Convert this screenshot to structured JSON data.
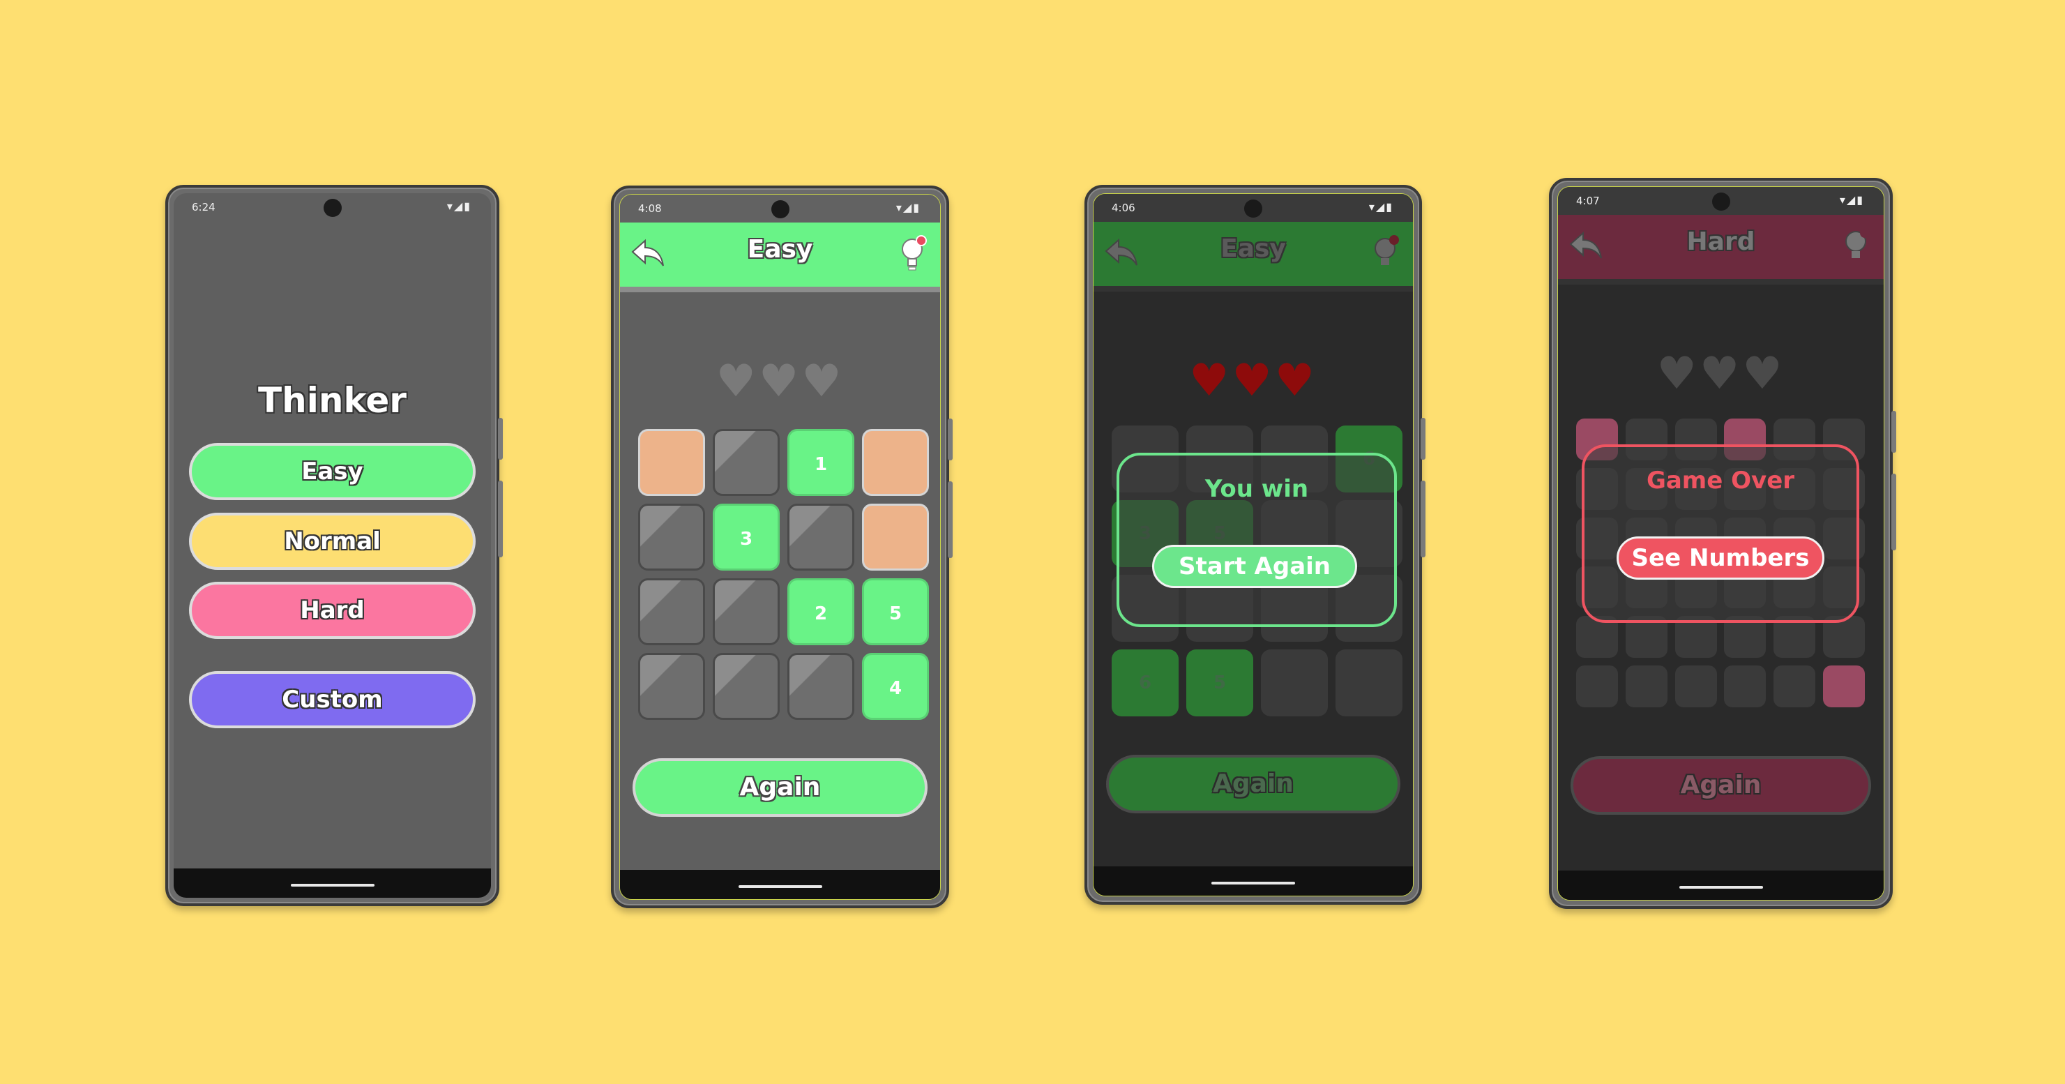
{
  "colors": {
    "background": "#FEDF71",
    "easy": "#69F387",
    "normal": "#FDDE72",
    "hard": "#FB76A0",
    "custom": "#7F6BF0",
    "revealed_tile": "#EDB38A",
    "hidden_tile": "#707070",
    "heart_gray": "#7a7a7a",
    "heart_red": "#8E0B0B",
    "win": "#6CE68C",
    "lose": "#EF5461"
  },
  "screens": [
    {
      "status_time": "6:24",
      "app_title": "Thinker",
      "menu": [
        "Easy",
        "Normal",
        "Hard",
        "Custom"
      ]
    },
    {
      "status_time": "4:08",
      "title": "Easy",
      "hearts": [
        "heart",
        "heart",
        "heart"
      ],
      "grid_rows": [
        [
          {
            "state": "revealed",
            "label": ""
          },
          {
            "state": "hidden",
            "label": ""
          },
          {
            "state": "number",
            "label": "1"
          },
          {
            "state": "revealed",
            "label": ""
          }
        ],
        [
          {
            "state": "hidden",
            "label": ""
          },
          {
            "state": "number",
            "label": "3"
          },
          {
            "state": "hidden",
            "label": ""
          },
          {
            "state": "revealed",
            "label": ""
          }
        ],
        [
          {
            "state": "hidden",
            "label": ""
          },
          {
            "state": "hidden",
            "label": ""
          },
          {
            "state": "number",
            "label": "2"
          },
          {
            "state": "number",
            "label": "5"
          }
        ],
        [
          {
            "state": "hidden",
            "label": ""
          },
          {
            "state": "hidden",
            "label": ""
          },
          {
            "state": "hidden",
            "label": ""
          },
          {
            "state": "number",
            "label": "4"
          }
        ]
      ],
      "again_label": "Again"
    },
    {
      "status_time": "4:06",
      "title": "Easy",
      "hearts": [
        "heart",
        "heart",
        "heart"
      ],
      "dialog_title": "You win",
      "dialog_button": "Start Again",
      "background_labels": [
        "3",
        "5",
        "6",
        "5",
        "6"
      ],
      "again_label": "Again"
    },
    {
      "status_time": "4:07",
      "title": "Hard",
      "hearts": [
        "heart",
        "heart",
        "heart"
      ],
      "dialog_title": "Game Over",
      "dialog_button": "See Numbers",
      "again_label": "Again"
    }
  ]
}
